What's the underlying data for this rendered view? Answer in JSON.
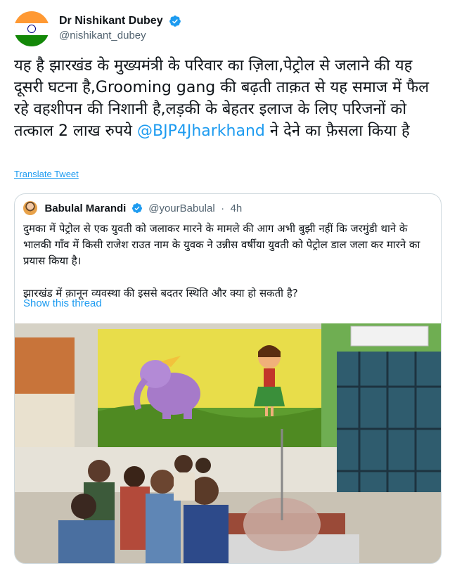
{
  "author": {
    "display_name": "Dr Nishikant Dubey",
    "handle": "@nishikant_dubey",
    "verified": true,
    "avatar_icon": "india-flag-avatar"
  },
  "tweet": {
    "text_before": "यह है झारखंड के मुख्यमंत्री के परिवार का ज़िला,पेट्रोल से जलाने की यह दूसरी घटना है,Grooming gang की बढ़ती ताक़त से यह समाज में फैल रहे वहशीपन की निशानी है,लड़की के बेहतर इलाज के लिए परिजनों को तत्काल 2 लाख रुपये ",
    "mention": "@BJP4Jharkhand",
    "text_after": " ने देने का फ़ैसला किया है",
    "translate_label": "Translate Tweet"
  },
  "quoted_tweet": {
    "display_name": "Babulal Marandi",
    "handle": "@yourBabulal",
    "separator": "·",
    "time": "4h",
    "verified": true,
    "text": "दुमका में पेट्रोल से एक युवती को जलाकर मारने के मामले की आग अभी बुझी नहीं कि जरमुंडी थाने के भालकी गाँव में किसी राजेश राउत नाम के युवक ने उन्नीस वर्षीया युवती को पेट्रोल डाल जला कर मारने का प्रयास किया है।\n\nझारखंड में क़ानून व्यवस्था की इससे बदतर स्थिति और क्या हो सकती है?",
    "show_thread_label": "Show this thread",
    "media_icon": "hospital-ward-photo"
  },
  "colors": {
    "link": "#1d9bf0",
    "text": "#0f1419",
    "muted": "#536471",
    "border": "#cfd9de"
  }
}
